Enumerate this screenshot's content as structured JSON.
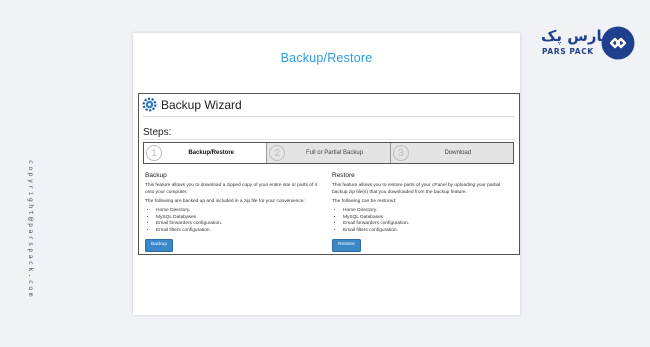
{
  "watermark": {
    "copyright": "copyright@parspack.com",
    "logo_fa": "پارس پک",
    "logo_en": "PARS PACK"
  },
  "page": {
    "title": "Backup/Restore"
  },
  "wizard": {
    "title": "Backup Wizard",
    "steps_label": "Steps:",
    "steps": [
      {
        "num": "1",
        "label": "Backup/Restore",
        "active": true
      },
      {
        "num": "2",
        "label": "Full or Partial Backup",
        "active": false
      },
      {
        "num": "3",
        "label": "Download",
        "active": false
      }
    ]
  },
  "backup": {
    "heading": "Backup",
    "description": "This feature allows you to download a zipped copy of your entire site or parts of it onto your computer.",
    "intro": "The following are backed up and included in a zip file for your convenience:",
    "items": [
      "Home Directory.",
      "MySQL Databases",
      "Email forwarders configuration.",
      "Email filters configuration."
    ],
    "button": "Backup"
  },
  "restore": {
    "heading": "Restore",
    "description": "This feature allows you to restore parts of your cPanel by uploading your partial backup zip file(s) that you downloaded from the backup feature.",
    "intro": "The following can be restored:",
    "items": [
      "Home Directory.",
      "MySQL Databases",
      "Email forwarders configuration.",
      "Email filters configuration."
    ],
    "button": "Restore"
  }
}
